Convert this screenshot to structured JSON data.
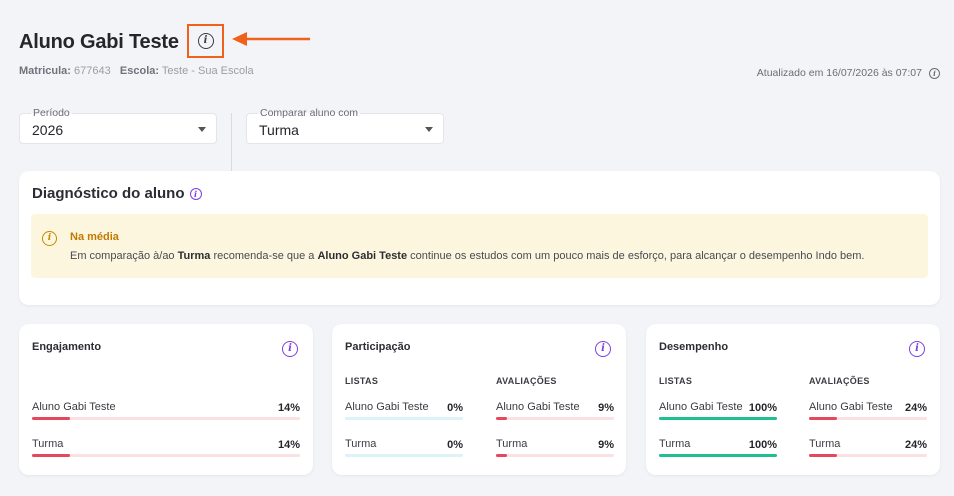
{
  "header": {
    "title": "Aluno Gabi Teste",
    "matricula_label": "Matricula:",
    "matricula_value": "677643",
    "escola_label": "Escola:",
    "escola_value": "Teste - Sua Escola",
    "updated": "Atualizado em 16/07/2026 às 07:07"
  },
  "filters": {
    "periodo": {
      "label": "Período",
      "value": "2026"
    },
    "comparar": {
      "label": "Comparar aluno com",
      "value": "Turma"
    }
  },
  "diagnostico": {
    "title": "Diagnóstico do aluno",
    "alert_title": "Na média",
    "text_1": "Em comparação à/ao ",
    "bold_1": "Turma",
    "text_2": " recomenda-se que a ",
    "bold_2": "Aluno Gabi Teste",
    "text_3": " continue os estudos com um pouco mais de esforço, para alcançar o desempenho Indo bem."
  },
  "colors": {
    "accent_purple": "#7b3fe4",
    "annotation_orange": "#f0611b",
    "red_bar": "#e5485d",
    "red_track": "#fbe0e4",
    "green_bar": "#1fbf8f",
    "cyan_track": "#dcf3f7"
  },
  "cards": {
    "engajamento": {
      "title": "Engajamento",
      "rows": [
        {
          "name": "Aluno Gabi Teste",
          "pct": "14%",
          "value": 0.14
        },
        {
          "name": "Turma",
          "pct": "14%",
          "value": 0.14
        }
      ]
    },
    "participacao": {
      "title": "Participação",
      "listas": {
        "heading": "LISTAS",
        "rows": [
          {
            "name": "Aluno Gabi Teste",
            "pct": "0%",
            "value": 0
          },
          {
            "name": "Turma",
            "pct": "0%",
            "value": 0
          }
        ]
      },
      "avaliacoes": {
        "heading": "AVALIAÇÕES",
        "rows": [
          {
            "name": "Aluno Gabi Teste",
            "pct": "9%",
            "value": 0.09
          },
          {
            "name": "Turma",
            "pct": "9%",
            "value": 0.09
          }
        ]
      }
    },
    "desempenho": {
      "title": "Desempenho",
      "listas": {
        "heading": "LISTAS",
        "rows": [
          {
            "name": "Aluno Gabi Teste",
            "pct": "100%",
            "value": 1.0
          },
          {
            "name": "Turma",
            "pct": "100%",
            "value": 1.0
          }
        ]
      },
      "avaliacoes": {
        "heading": "AVALIAÇÕES",
        "rows": [
          {
            "name": "Aluno Gabi Teste",
            "pct": "24%",
            "value": 0.24
          },
          {
            "name": "Turma",
            "pct": "24%",
            "value": 0.24
          }
        ]
      }
    }
  }
}
